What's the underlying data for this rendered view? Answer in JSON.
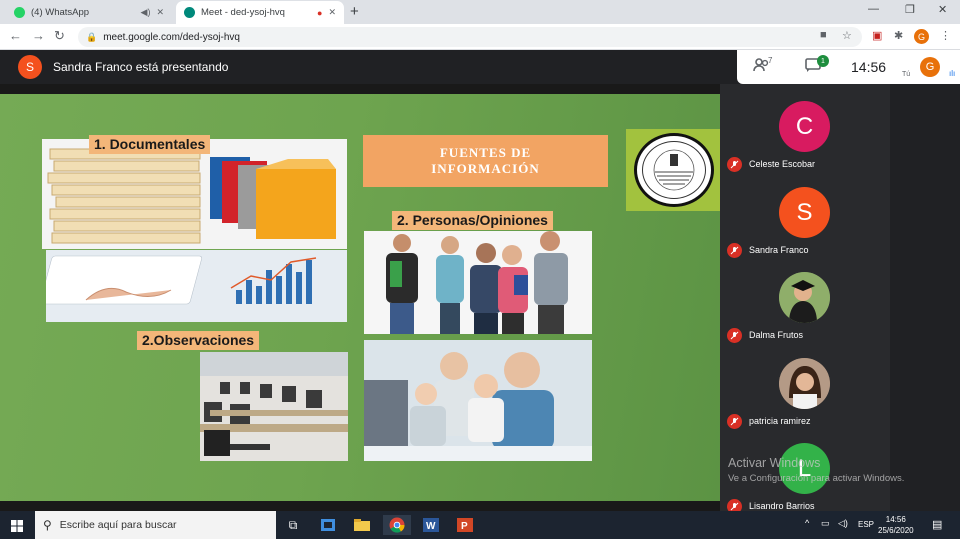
{
  "browser": {
    "tabs": [
      {
        "title": "(4) WhatsApp",
        "favicon_color": "#25d366"
      },
      {
        "title": "Meet - ded-ysoj-hvq",
        "favicon_color": "#00897b"
      }
    ],
    "url": "meet.google.com/ded-ysoj-hvq",
    "profile_initial": "G"
  },
  "meet": {
    "presenter_initial": "S",
    "presenting_text": "Sandra Franco está presentando",
    "participant_count": "7",
    "chat_badge": "1",
    "time": "14:56",
    "self_label": "Tú",
    "self_initial": "G"
  },
  "slide": {
    "label_documentales": "1. Documentales",
    "label_observaciones": "2.Observaciones",
    "label_personas": "2. Personas/Opiniones",
    "fuentes_line1": "FUENTES DE",
    "fuentes_line2": "INFORMACIÓN"
  },
  "participants": [
    {
      "name": "Celeste Escobar",
      "initial": "C",
      "color": "#d81b60"
    },
    {
      "name": "Sandra Franco",
      "initial": "S",
      "color": "#f4511e"
    },
    {
      "name": "Dalma Frutos",
      "initial": "",
      "color": "#5f7d4a"
    },
    {
      "name": "patricia ramirez",
      "initial": "",
      "color": "#8a6a55"
    },
    {
      "name": "Lisandro Barrios",
      "initial": "L",
      "color": "#33b249"
    }
  ],
  "watermark": {
    "title": "Activar Windows",
    "subtitle": "Ve a Configuración para activar Windows."
  },
  "taskbar": {
    "search_placeholder": "Escribe aquí para buscar",
    "lang": "ESP",
    "time": "14:56",
    "date": "25/6/2020"
  }
}
